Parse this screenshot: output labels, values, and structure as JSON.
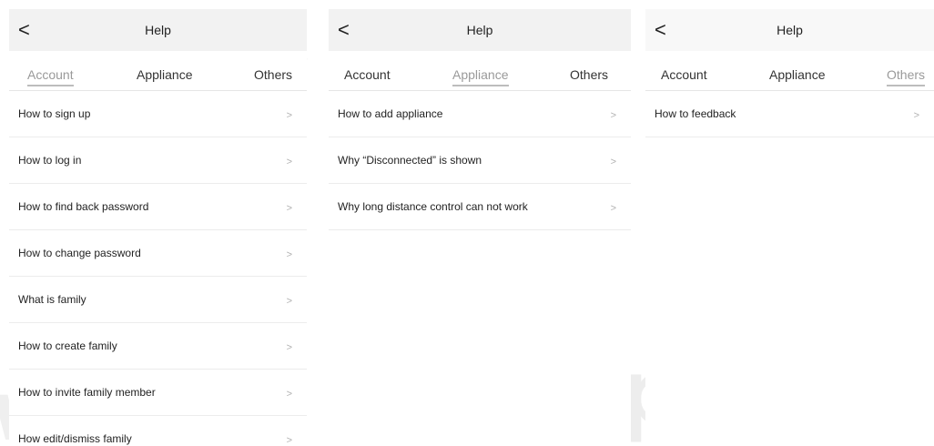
{
  "panels": [
    {
      "back": "<",
      "title": "Help",
      "tabs": [
        "Account",
        "Appliance",
        "Others"
      ],
      "active_tab": "Account",
      "items": [
        "How to sign up",
        "How to log in",
        "How to find back password",
        "How to change password",
        "What is family",
        "How to create family",
        "How to invite family member",
        "How edit/dismiss family"
      ]
    },
    {
      "back": "<",
      "title": "Help",
      "tabs": [
        "Account",
        "Appliance",
        "Others"
      ],
      "active_tab": "Appliance",
      "items": [
        "How to add appliance",
        "Why “Disconnected” is shown",
        "Why long distance control can not work"
      ]
    },
    {
      "back": "<",
      "title": "Help",
      "tabs": [
        "Account",
        "Appliance",
        "Others"
      ],
      "active_tab": "Others",
      "items": [
        "How to feedback"
      ]
    }
  ],
  "chevron": ">",
  "watermark": {
    "right": "tpiab.c",
    "left": "w."
  }
}
